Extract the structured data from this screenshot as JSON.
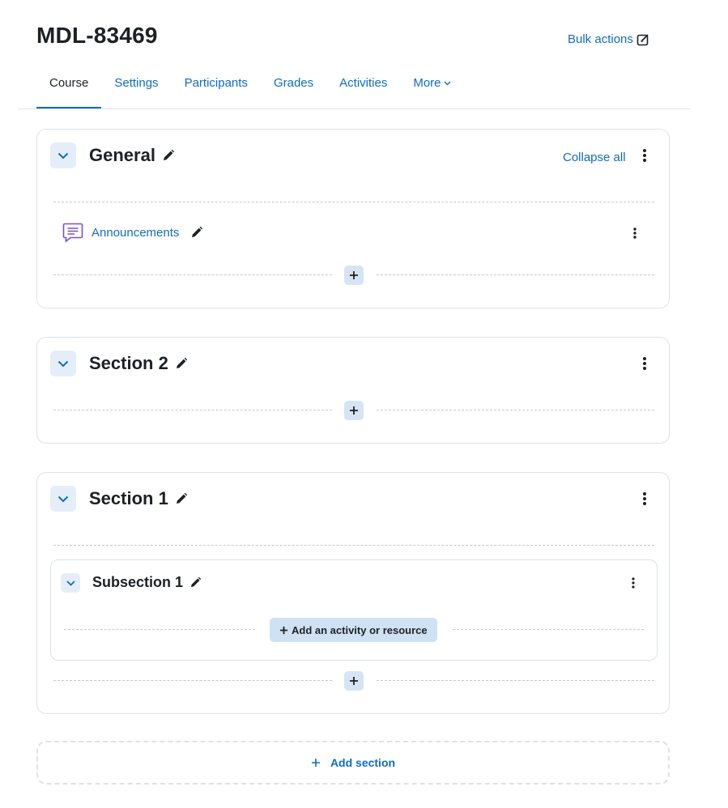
{
  "header": {
    "title": "MDL-83469",
    "bulk_actions_label": "Bulk actions"
  },
  "nav": {
    "tabs": [
      {
        "label": "Course",
        "active": true
      },
      {
        "label": "Settings"
      },
      {
        "label": "Participants"
      },
      {
        "label": "Grades"
      },
      {
        "label": "Activities"
      },
      {
        "label": "More"
      }
    ]
  },
  "sections": [
    {
      "title": "General",
      "collapse_all_label": "Collapse all",
      "activities": [
        {
          "name": "Announcements",
          "icon": "forum-icon"
        }
      ]
    },
    {
      "title": "Section 2",
      "activities": []
    },
    {
      "title": "Section 1",
      "subsections": [
        {
          "title": "Subsection 1",
          "add_activity_label": "Add an activity or resource"
        }
      ]
    }
  ],
  "add_section_label": "Add section",
  "colors": {
    "accent": "#0f6cbf",
    "text": "#1d2125",
    "button_bg": "#e5eef8"
  }
}
